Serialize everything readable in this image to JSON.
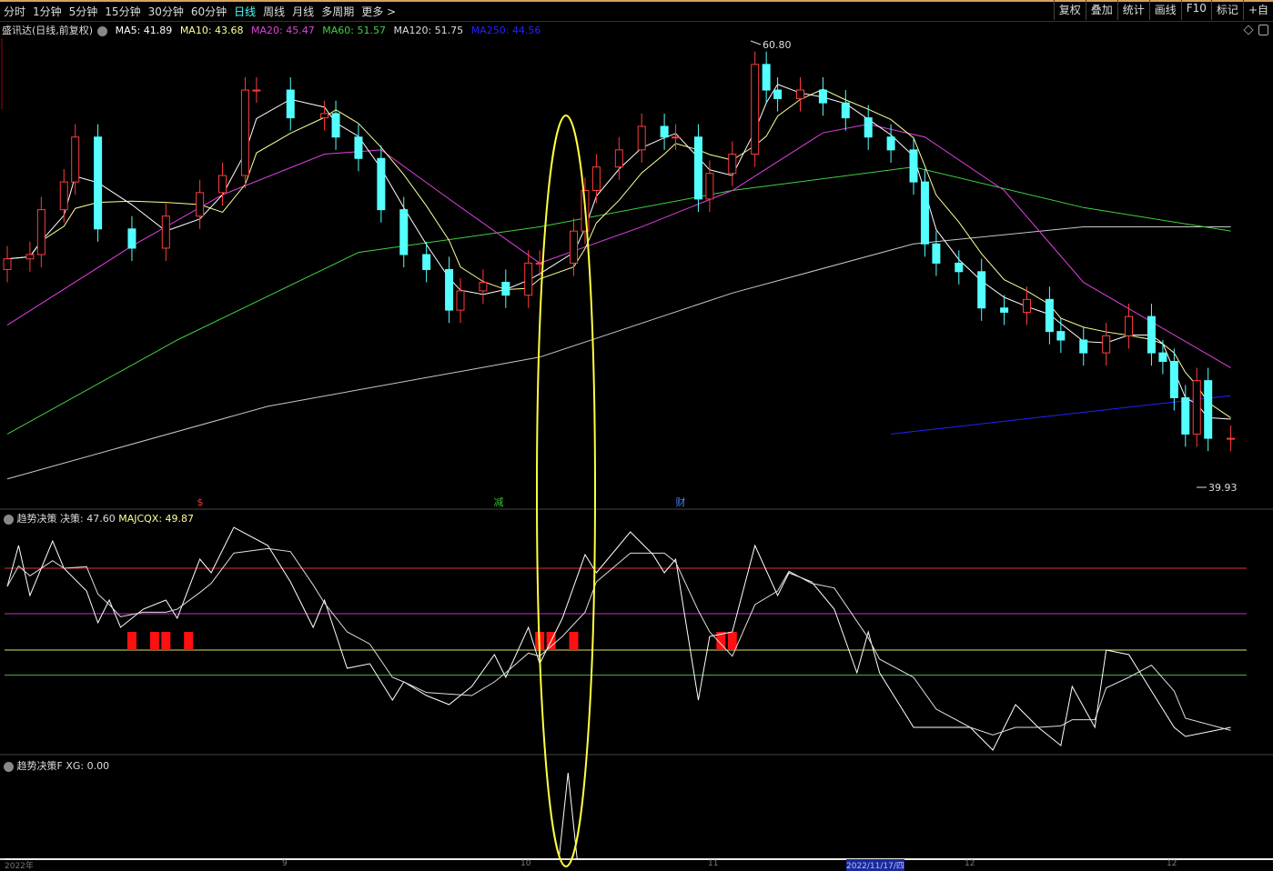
{
  "toolbar": {
    "periods": [
      "分时",
      "1分钟",
      "5分钟",
      "15分钟",
      "30分钟",
      "60分钟",
      "日线",
      "周线",
      "月线",
      "多周期",
      "更多 >"
    ],
    "active": "日线",
    "right": [
      "复权",
      "叠加",
      "统计",
      "画线",
      "F10",
      "标记",
      "+自"
    ]
  },
  "legend": {
    "stock": "盛讯达(日线,前复权)",
    "ma5": "MA5: 41.89",
    "ma10": "MA10: 43.68",
    "ma20": "MA20: 45.47",
    "ma60": "MA60: 51.57",
    "ma120": "MA120: 51.75",
    "ma250": "MA250: 44.56"
  },
  "colors": {
    "up": "#ff3c3c",
    "down": "#54ffff",
    "ma5": "#ffffff",
    "ma10": "#ffff99",
    "ma20": "#e040e0",
    "ma60": "#40d040",
    "ma120": "#c8c8c8",
    "ma250": "#2222ff",
    "highlight": "#ffff40"
  },
  "price_labels": {
    "high": "60.80",
    "low": "39.93"
  },
  "events": [
    {
      "text": "$",
      "color": "#ff3030"
    },
    {
      "text": "减",
      "color": "#30c030"
    },
    {
      "text": "财",
      "color": "#4080ff"
    }
  ],
  "indicator1": {
    "name": "趋势决策",
    "decision": "决策: 47.60",
    "majcqx": "MAJCQX: 49.87"
  },
  "indicator2": {
    "name": "趋势决策F",
    "xg": "XG: 0.00"
  },
  "axis": {
    "labels": [
      "2022年",
      "9",
      "10",
      "11",
      "2022/11/17/四",
      "12",
      "12"
    ]
  },
  "chart_data": {
    "type": "candlestick",
    "candles": [
      [
        0,
        50.6
      ],
      [
        2,
        50.8
      ],
      [
        3,
        52.9
      ],
      [
        5,
        54.2
      ],
      [
        6,
        56.3
      ],
      [
        8,
        52.0
      ],
      [
        11,
        51.1
      ],
      [
        14,
        52.6
      ],
      [
        17,
        53.7
      ],
      [
        19,
        54.5
      ],
      [
        21,
        58.5
      ],
      [
        22,
        58.5
      ],
      [
        25,
        57.2
      ],
      [
        28,
        57.4
      ],
      [
        29,
        56.3
      ],
      [
        31,
        55.3
      ],
      [
        33,
        52.9
      ],
      [
        35,
        50.8
      ],
      [
        37,
        50.1
      ],
      [
        39,
        48.2
      ],
      [
        40,
        49.1
      ],
      [
        42,
        49.5
      ],
      [
        44,
        48.9
      ],
      [
        46,
        50.4
      ],
      [
        47,
        50.4
      ],
      [
        50,
        51.9
      ],
      [
        51,
        53.8
      ],
      [
        52,
        54.9
      ],
      [
        54,
        55.7
      ],
      [
        56,
        56.8
      ],
      [
        58,
        56.3
      ],
      [
        59,
        56.3
      ],
      [
        61,
        53.4
      ],
      [
        62,
        54.6
      ],
      [
        64,
        55.5
      ],
      [
        66,
        59.7
      ],
      [
        67,
        58.5
      ],
      [
        68,
        58.1
      ],
      [
        70,
        58.5
      ],
      [
        72,
        57.9
      ],
      [
        74,
        57.2
      ],
      [
        76,
        56.3
      ],
      [
        78,
        55.7
      ],
      [
        80,
        54.2
      ],
      [
        81,
        51.3
      ],
      [
        82,
        50.4
      ],
      [
        84,
        50.0
      ],
      [
        86,
        48.3
      ],
      [
        88,
        48.1
      ],
      [
        90,
        48.7
      ],
      [
        92,
        47.2
      ],
      [
        93,
        46.8
      ],
      [
        95,
        46.2
      ],
      [
        97,
        47.0
      ],
      [
        99,
        47.9
      ],
      [
        101,
        46.2
      ],
      [
        102,
        45.8
      ],
      [
        103,
        44.1
      ],
      [
        104,
        42.4
      ],
      [
        105,
        44.9
      ],
      [
        106,
        42.2
      ],
      [
        108,
        42.2
      ]
    ],
    "ma20": [
      [
        0,
        47.5
      ],
      [
        11,
        51.2
      ],
      [
        19,
        53.6
      ],
      [
        28,
        55.5
      ],
      [
        33,
        55.7
      ],
      [
        39,
        53.4
      ],
      [
        47,
        50.4
      ],
      [
        56,
        52.1
      ],
      [
        64,
        53.8
      ],
      [
        72,
        56.5
      ],
      [
        76,
        56.9
      ],
      [
        81,
        56.3
      ],
      [
        88,
        53.8
      ],
      [
        95,
        49.5
      ],
      [
        108,
        45.5
      ]
    ],
    "ma60": [
      [
        0,
        42.4
      ],
      [
        15,
        46.8
      ],
      [
        31,
        50.9
      ],
      [
        47,
        52.1
      ],
      [
        64,
        53.8
      ],
      [
        80,
        54.9
      ],
      [
        95,
        53.0
      ],
      [
        108,
        51.9
      ]
    ],
    "ma120": [
      [
        0,
        40.3
      ],
      [
        23,
        43.7
      ],
      [
        47,
        46.0
      ],
      [
        64,
        49.0
      ],
      [
        80,
        51.3
      ],
      [
        95,
        52.1
      ],
      [
        108,
        52.1
      ]
    ],
    "trendline": [
      [
        78,
        42.4
      ],
      [
        108,
        44.2
      ]
    ],
    "indicator": [
      [
        0,
        74
      ],
      [
        1,
        92
      ],
      [
        2,
        70
      ],
      [
        4,
        94
      ],
      [
        5,
        82
      ],
      [
        7,
        72
      ],
      [
        8,
        58
      ],
      [
        9,
        68
      ],
      [
        10,
        56
      ],
      [
        12,
        64
      ],
      [
        14,
        68
      ],
      [
        15,
        60
      ],
      [
        17,
        86
      ],
      [
        18,
        80
      ],
      [
        20,
        100
      ],
      [
        23,
        92
      ],
      [
        25,
        76
      ],
      [
        27,
        56
      ],
      [
        28,
        68
      ],
      [
        30,
        38
      ],
      [
        32,
        40
      ],
      [
        34,
        24
      ],
      [
        35,
        32
      ],
      [
        37,
        26
      ],
      [
        39,
        22
      ],
      [
        41,
        30
      ],
      [
        43,
        44
      ],
      [
        44,
        34
      ],
      [
        46,
        56
      ],
      [
        47,
        40
      ],
      [
        49,
        60
      ],
      [
        51,
        88
      ],
      [
        52,
        80
      ],
      [
        55,
        98
      ],
      [
        57,
        88
      ],
      [
        58,
        80
      ],
      [
        59,
        86
      ],
      [
        61,
        24
      ],
      [
        62,
        52
      ],
      [
        64,
        54
      ],
      [
        66,
        92
      ],
      [
        68,
        70
      ],
      [
        69,
        80
      ],
      [
        71,
        76
      ],
      [
        73,
        64
      ],
      [
        75,
        36
      ],
      [
        76,
        54
      ],
      [
        77,
        36
      ],
      [
        80,
        12
      ],
      [
        82,
        12
      ],
      [
        85,
        12
      ],
      [
        87,
        2
      ],
      [
        89,
        22
      ],
      [
        91,
        12
      ],
      [
        93,
        4
      ],
      [
        94,
        30
      ],
      [
        96,
        12
      ],
      [
        97,
        46
      ],
      [
        99,
        44
      ],
      [
        101,
        28
      ],
      [
        103,
        12
      ],
      [
        104,
        8
      ],
      [
        108,
        12
      ]
    ],
    "levels": {
      "red": 82,
      "magenta": 62,
      "yellow": 46,
      "green": 35
    },
    "signals": [
      11,
      13,
      14,
      16,
      47,
      48,
      50,
      63,
      64
    ],
    "xg_spike_day": 49.5
  }
}
